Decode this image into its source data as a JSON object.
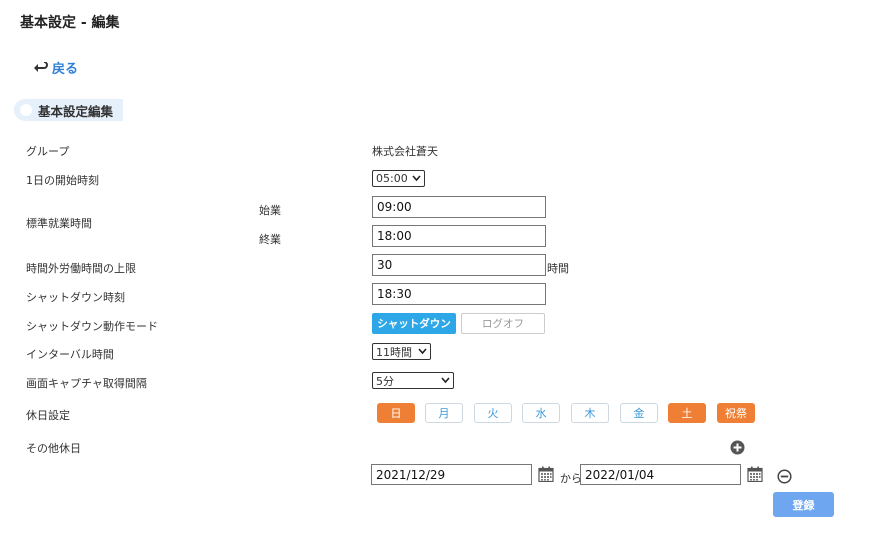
{
  "page": {
    "title": "基本設定 - 編集",
    "back_label": "戻る"
  },
  "section": {
    "title": "基本設定編集"
  },
  "group": {
    "label": "グループ",
    "value": "株式会社蒼天"
  },
  "day_start": {
    "label": "1日の開始時刻",
    "value": "05:00"
  },
  "standard_hours": {
    "label": "標準就業時間",
    "start_label": "始業",
    "start_value": "09:00",
    "end_label": "終業",
    "end_value": "18:00"
  },
  "overtime_limit": {
    "label": "時間外労働時間の上限",
    "value": "30",
    "unit": "時間"
  },
  "shutdown_time": {
    "label": "シャットダウン時刻",
    "value": "18:30"
  },
  "shutdown_mode": {
    "label": "シャットダウン動作モード",
    "options": [
      "シャットダウン",
      "ログオフ"
    ],
    "selected": "シャットダウン"
  },
  "interval": {
    "label": "インターバル時間",
    "value": "11時間"
  },
  "capture_interval": {
    "label": "画面キャプチャ取得間隔",
    "value": "5分"
  },
  "holidays": {
    "label": "休日設定",
    "days": [
      {
        "label": "日",
        "selected": true
      },
      {
        "label": "月",
        "selected": false
      },
      {
        "label": "火",
        "selected": false
      },
      {
        "label": "水",
        "selected": false
      },
      {
        "label": "木",
        "selected": false
      },
      {
        "label": "金",
        "selected": false
      },
      {
        "label": "土",
        "selected": true
      },
      {
        "label": "祝祭",
        "selected": true
      }
    ]
  },
  "other_holidays": {
    "label": "その他休日",
    "from": "2021/12/29",
    "separator": "から",
    "to": "2022/01/04"
  },
  "submit": {
    "label": "登録"
  },
  "colors": {
    "accent_blue": "#2ea7e9",
    "holiday_orange": "#ef7f35",
    "submit_blue": "#6fa6f0",
    "link_blue": "#2f7fd6"
  }
}
